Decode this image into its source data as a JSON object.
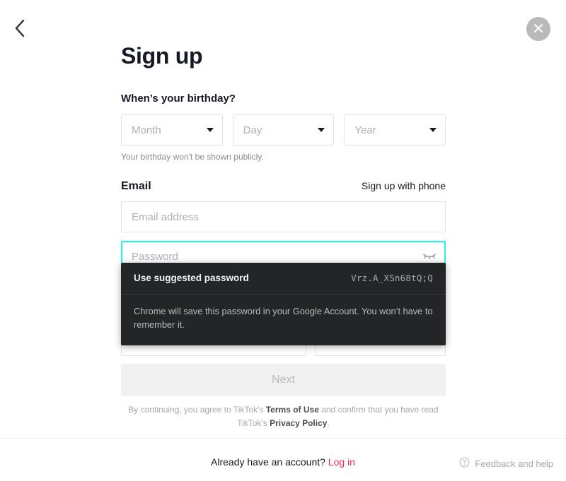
{
  "header": {
    "back_icon": "chevron-left-icon",
    "close_icon": "close-icon"
  },
  "main": {
    "title": "Sign up",
    "birthday_label": "When’s your birthday?",
    "birthday": {
      "month_placeholder": "Month",
      "day_placeholder": "Day",
      "year_placeholder": "Year",
      "hint": "Your birthday won't be shown publicly."
    },
    "email_section": {
      "label": "Email",
      "phone_link": "Sign up with phone",
      "email_placeholder": "Email address",
      "email_value": "",
      "password_placeholder": "Password",
      "password_value": "",
      "eye_icon": "eye-off-icon"
    },
    "next_label": "Next",
    "legal": {
      "part1": "By continuing, you agree to TikTok's ",
      "terms": "Terms of Use",
      "part2": " and confirm that you have read TikTok's ",
      "privacy": "Privacy Policy",
      "part3": "."
    }
  },
  "password_dropdown": {
    "suggest_label": "Use suggested password",
    "suggested_password": "Vrz.A_XSn68tQ;Q",
    "description": "Chrome will save this password in your Google Account. You won’t have to remember it."
  },
  "bottom_bar": {
    "account_prompt": "Already have an account?",
    "login_label": "Log in",
    "feedback_label": "Feedback and help",
    "feedback_icon": "question-circle-icon"
  },
  "colors": {
    "brand_cyan": "#25F4EE",
    "brand_red": "#FE2C55",
    "text_primary": "#161823",
    "dropdown_bg": "#242526"
  }
}
